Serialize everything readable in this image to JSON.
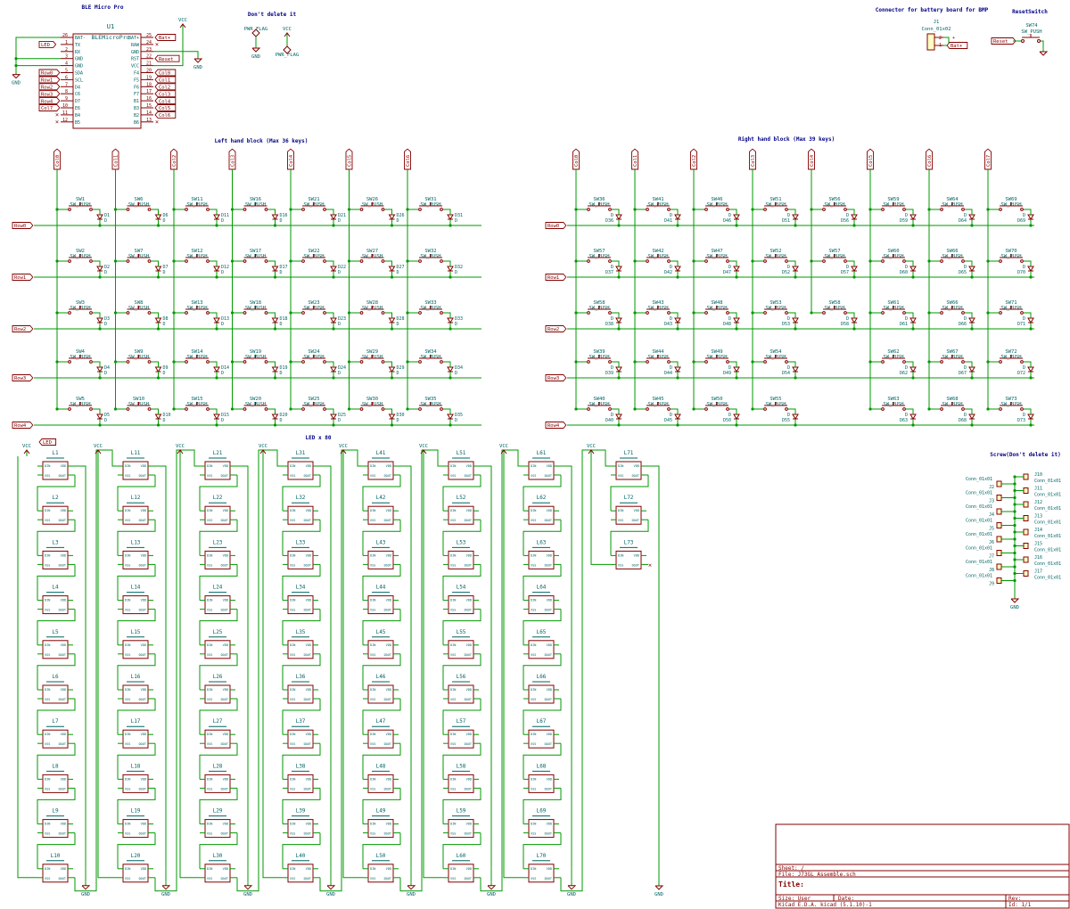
{
  "colors": {
    "wire": "#009900",
    "part": "#840000",
    "text": "#006464",
    "label": "#840000",
    "title": "#000084",
    "power": "#840000"
  },
  "header": {
    "mcu_title": "BLE Micro Pro",
    "dont_delete": "Don't delete it",
    "connector_title": "Connector for battery board for BMP",
    "reset_title": "ResetSwitch"
  },
  "mcu": {
    "ref": "U1",
    "value": "BLEMicroPro",
    "left_pins": [
      {
        "num": "26",
        "name": "BAT-",
        "net": ""
      },
      {
        "num": "1",
        "name": "TX",
        "net": "LED"
      },
      {
        "num": "2",
        "name": "RX",
        "net": ""
      },
      {
        "num": "3",
        "name": "GND",
        "net": ""
      },
      {
        "num": "4",
        "name": "GND",
        "net": ""
      },
      {
        "num": "5",
        "name": "SDA",
        "net": "Row0"
      },
      {
        "num": "6",
        "name": "SCL",
        "net": "Row1"
      },
      {
        "num": "7",
        "name": "D4",
        "net": "Row2"
      },
      {
        "num": "8",
        "name": "C6",
        "net": "Row3"
      },
      {
        "num": "9",
        "name": "D7",
        "net": "Row4"
      },
      {
        "num": "10",
        "name": "E6",
        "net": "Col7"
      },
      {
        "num": "11",
        "name": "B4",
        "net": ""
      },
      {
        "num": "12",
        "name": "B5",
        "net": ""
      }
    ],
    "right_pins": [
      {
        "num": "25",
        "name": "BAT+",
        "net": "Bat+"
      },
      {
        "num": "24",
        "name": "RAW",
        "net": ""
      },
      {
        "num": "23",
        "name": "GND",
        "net": ""
      },
      {
        "num": "22",
        "name": "RST",
        "net": "Reset"
      },
      {
        "num": "21",
        "name": "VCC",
        "net": ""
      },
      {
        "num": "20",
        "name": "F4",
        "net": "Col0"
      },
      {
        "num": "19",
        "name": "F5",
        "net": "Col1"
      },
      {
        "num": "18",
        "name": "F6",
        "net": "Col2"
      },
      {
        "num": "17",
        "name": "F7",
        "net": "Col3"
      },
      {
        "num": "16",
        "name": "B1",
        "net": "Col4"
      },
      {
        "num": "15",
        "name": "B3",
        "net": "Col5"
      },
      {
        "num": "14",
        "name": "B2",
        "net": "Col6"
      },
      {
        "num": "13",
        "name": "B6",
        "net": ""
      }
    ],
    "vcc": "VCC",
    "gnd": "GND"
  },
  "power_flags": {
    "pwr_flag": "PWR_FLAG",
    "vcc": "VCC",
    "gnd": "GND"
  },
  "connector": {
    "ref": "J1",
    "value": "Conn_01x02",
    "net": "Bat+",
    "pin1": "1",
    "pin2": "2"
  },
  "reset_switch": {
    "ref": "SW74",
    "value": "SW_PUSH",
    "net": "Reset"
  },
  "left_block": {
    "title": "Left hand block (Max 36 keys)",
    "cols": [
      "Col0",
      "Col1",
      "Col2",
      "Col3",
      "Col4",
      "Col5",
      "Col6"
    ],
    "rows": [
      "Row0",
      "Row1",
      "Row2",
      "Row3",
      "Row4"
    ],
    "switch_value": "SW_PUSH",
    "diode_value": "D",
    "switches": [
      [
        "SW1",
        "SW2",
        "SW3",
        "SW4",
        "SW5"
      ],
      [
        "SW6",
        "SW7",
        "SW8",
        "SW9",
        "SW10"
      ],
      [
        "SW11",
        "SW12",
        "SW13",
        "SW14",
        "SW15"
      ],
      [
        "SW16",
        "SW17",
        "SW18",
        "SW19",
        "SW20"
      ],
      [
        "SW21",
        "SW22",
        "SW23",
        "SW24",
        "SW25"
      ],
      [
        "SW26",
        "SW27",
        "SW28",
        "SW29",
        "SW30"
      ],
      [
        "SW31",
        "SW32",
        "SW33",
        "SW34",
        "SW35"
      ]
    ],
    "diodes": [
      [
        "D1",
        "D2",
        "D3",
        "D4",
        "D5"
      ],
      [
        "D6",
        "D7",
        "D8",
        "D9",
        "D10"
      ],
      [
        "D11",
        "D12",
        "D13",
        "D14",
        "D15"
      ],
      [
        "D16",
        "D17",
        "D18",
        "D19",
        "D20"
      ],
      [
        "D21",
        "D22",
        "D23",
        "D24",
        "D25"
      ],
      [
        "D26",
        "D27",
        "D28",
        "D29",
        "D30"
      ],
      [
        "D31",
        "D32",
        "D33",
        "D34",
        "D35"
      ]
    ]
  },
  "right_block": {
    "title": "Right hand block (Max 39 keys)",
    "cols": [
      "Col0",
      "Col1",
      "Col2",
      "Col3",
      "Col4",
      "Col5",
      "Col6",
      "Col7"
    ],
    "rows": [
      "Row0",
      "Row1",
      "Row2",
      "Row3",
      "Row4"
    ],
    "switches": [
      [
        "SW36",
        "SW57",
        "SW58",
        "SW39",
        "SW40"
      ],
      [
        "SW41",
        "SW42",
        "SW43",
        "SW44",
        "SW45"
      ],
      [
        "SW46",
        "SW47",
        "SW48",
        "SW49",
        "SW50"
      ],
      [
        "SW51",
        "SW52",
        "SW53",
        "SW54",
        "SW55"
      ],
      [
        "SW56",
        "SW57",
        "SW58",
        "",
        ""
      ],
      [
        "SW59",
        "SW60",
        "SW61",
        "SW62",
        "SW63"
      ],
      [
        "SW64",
        "SW66",
        "SW66",
        "SW67",
        "SW68"
      ],
      [
        "SW69",
        "SW70",
        "SW71",
        "SW72",
        "SW73"
      ]
    ],
    "diodes": [
      [
        "D36",
        "D37",
        "D38",
        "D39",
        "D40"
      ],
      [
        "D41",
        "D42",
        "D43",
        "D44",
        "D45"
      ],
      [
        "D46",
        "D47",
        "D48",
        "D49",
        "D50"
      ],
      [
        "D51",
        "D52",
        "D53",
        "D54",
        "D55"
      ],
      [
        "D56",
        "D57",
        "D58",
        "",
        ""
      ],
      [
        "D59",
        "D60",
        "D61",
        "D62",
        "D63"
      ],
      [
        "D64",
        "D65",
        "D66",
        "D67",
        "D68"
      ],
      [
        "D69",
        "D70",
        "D71",
        "D72",
        "D73"
      ]
    ]
  },
  "leds": {
    "title": "LED x 80",
    "net": "LED",
    "vcc": "VCC",
    "gnd": "GND",
    "pins": {
      "tl": "DIN",
      "tr": "VDD",
      "bl": "VSS",
      "br": "DOUT"
    },
    "columns": [
      [
        "L1",
        "L2",
        "L3",
        "L4",
        "L5",
        "L6",
        "L7",
        "L8",
        "L9",
        "L10"
      ],
      [
        "L11",
        "L12",
        "L13",
        "L14",
        "L15",
        "L16",
        "L17",
        "L18",
        "L19",
        "L20"
      ],
      [
        "L21",
        "L22",
        "L23",
        "L24",
        "L25",
        "L26",
        "L27",
        "L28",
        "L29",
        "L30"
      ],
      [
        "L31",
        "L32",
        "L33",
        "L34",
        "L35",
        "L36",
        "L37",
        "L38",
        "L39",
        "L40"
      ],
      [
        "L41",
        "L42",
        "L43",
        "L44",
        "L45",
        "L46",
        "L47",
        "L48",
        "L49",
        "L50"
      ],
      [
        "L51",
        "L52",
        "L53",
        "L54",
        "L55",
        "L56",
        "L57",
        "L58",
        "L59",
        "L60"
      ],
      [
        "L61",
        "L62",
        "L63",
        "L64",
        "L65",
        "L66",
        "L67",
        "L68",
        "L69",
        "L70"
      ],
      [
        "L71",
        "L72",
        "L73"
      ]
    ]
  },
  "screws": {
    "title": "Screw(Don't delete it)",
    "value": "Conn_01x01",
    "left": [
      "J2",
      "J3",
      "J4",
      "J5",
      "J6",
      "J7",
      "J8",
      "J9"
    ],
    "right": [
      "J10",
      "J11",
      "J12",
      "J13",
      "J14",
      "J15",
      "J16",
      "J17"
    ],
    "gnd": "GND"
  },
  "title_block": {
    "sheet": "Sheet: /",
    "file": "File: J73GL_Assemble.sch",
    "title": "Title:",
    "size": "Size: User",
    "date": "Date:",
    "rev": "Rev:",
    "kicad": "KiCad E.D.A.  kicad (5.1.10)-1",
    "id": "Id: 1/1"
  }
}
